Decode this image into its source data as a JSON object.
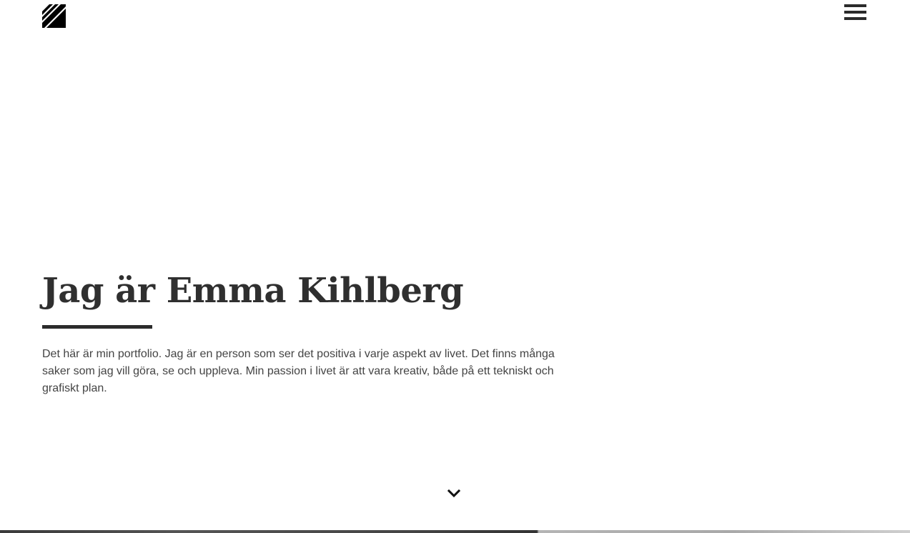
{
  "header": {
    "logo_icon": "diagonal-stripes-logo",
    "menu_icon": "hamburger-menu-icon"
  },
  "hero": {
    "title": "Jag är Emma Kihlberg",
    "text": "Det här är min portfolio. Jag är en person som ser det positiva i varje aspekt av livet. Det finns många saker som jag vill göra, se och uppleva. Min passion i livet är att vara kreativ, både på ett tekniskt och grafiskt plan."
  },
  "navigation": {
    "scroll_icon": "chevron-down-icon"
  },
  "colors": {
    "text": "#2f2f2f",
    "body_text": "#444444",
    "accent": "#2b2b2b",
    "background": "#ffffff"
  }
}
